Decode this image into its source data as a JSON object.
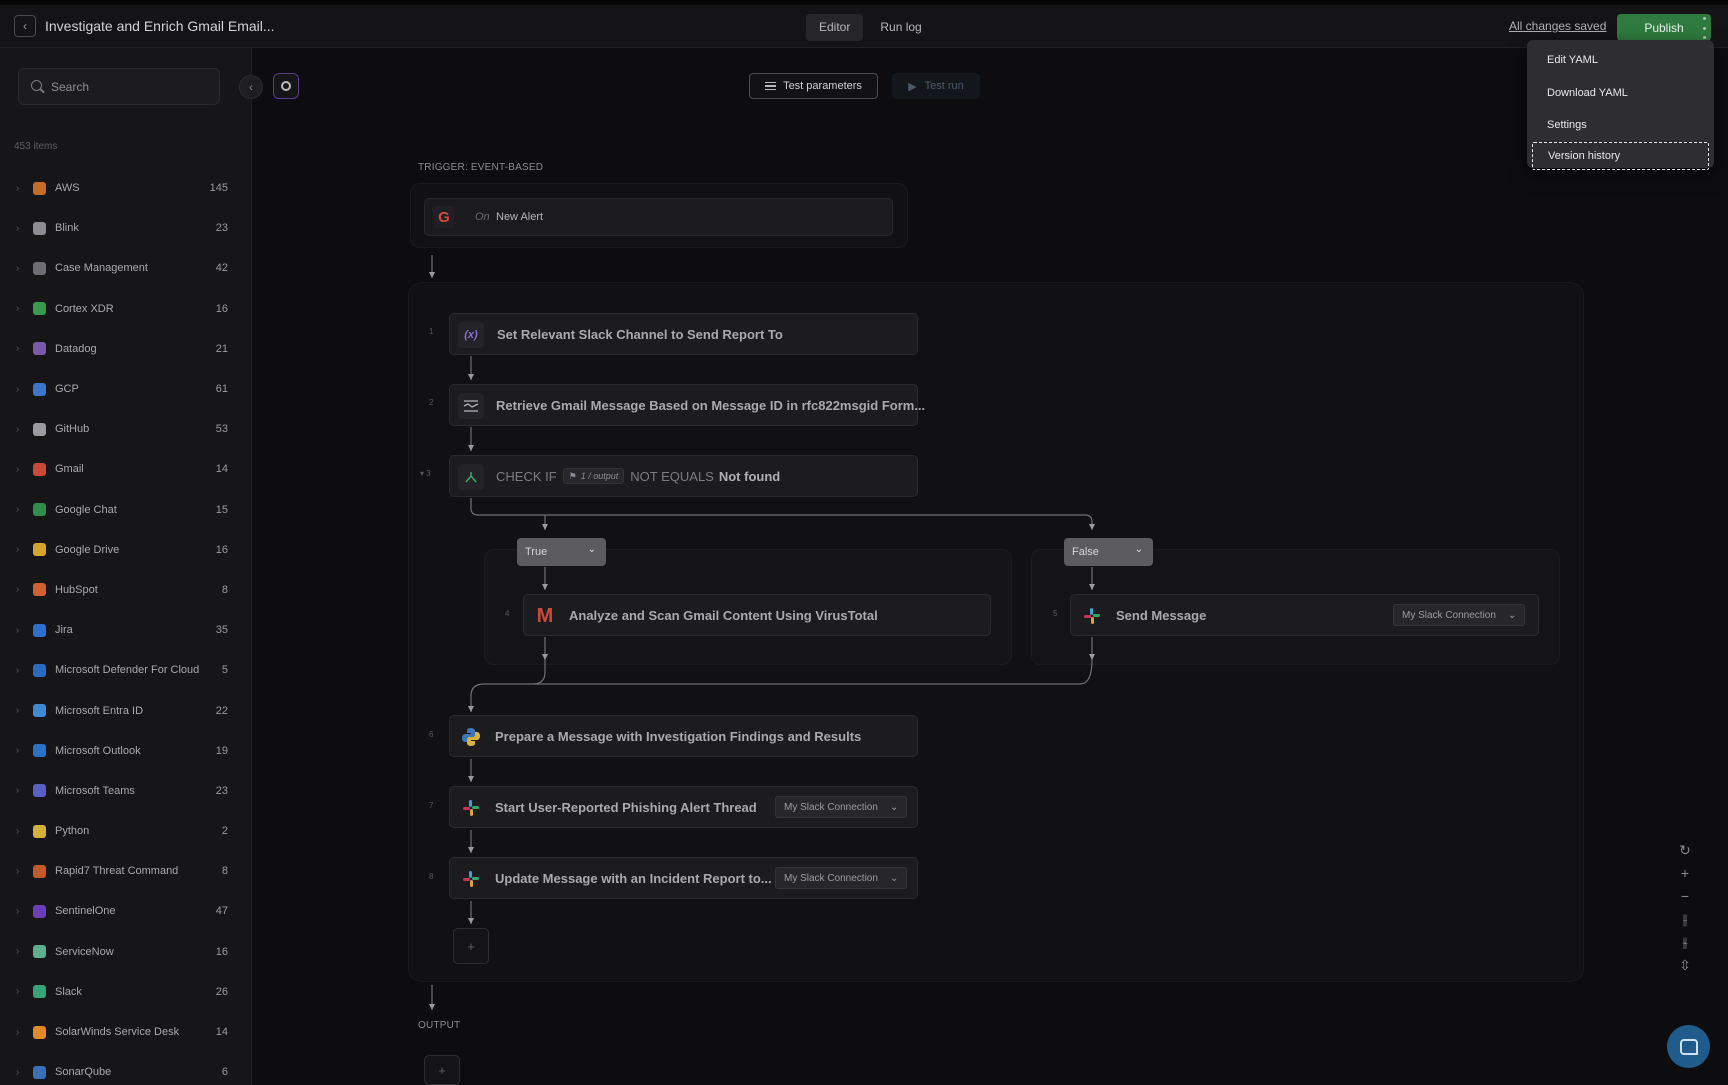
{
  "header": {
    "back_icon": "chevron-left-icon",
    "title": "Investigate and Enrich Gmail Email...",
    "tabs": [
      {
        "label": "Editor"
      },
      {
        "label": "Run log"
      }
    ],
    "saved_status": "All changes saved",
    "publish_label": "Publish",
    "more_icon": "kebab-menu-icon"
  },
  "menu": {
    "items": [
      {
        "label": "Edit YAML"
      },
      {
        "label": "Download YAML"
      },
      {
        "label": "Settings"
      },
      {
        "label": "Version history"
      }
    ]
  },
  "sidebar": {
    "search_placeholder": "Search",
    "item_count": "453 items",
    "items": [
      {
        "name": "AWS",
        "count": "145",
        "color": "#c46d2b"
      },
      {
        "name": "Blink",
        "count": "23",
        "color": "#8c8c92"
      },
      {
        "name": "Case Management",
        "count": "42",
        "color": "#6d6d73"
      },
      {
        "name": "Cortex XDR",
        "count": "16",
        "color": "#3a9a4b"
      },
      {
        "name": "Datadog",
        "count": "21",
        "color": "#7a5aa6"
      },
      {
        "name": "GCP",
        "count": "61",
        "color": "#3c76c9"
      },
      {
        "name": "GitHub",
        "count": "53",
        "color": "#9a9aa0"
      },
      {
        "name": "Gmail",
        "count": "14",
        "color": "#c9493b"
      },
      {
        "name": "Google Chat",
        "count": "15",
        "color": "#2f8f4a"
      },
      {
        "name": "Google Drive",
        "count": "16",
        "color": "#d4a72c"
      },
      {
        "name": "HubSpot",
        "count": "8",
        "color": "#d0602f"
      },
      {
        "name": "Jira",
        "count": "35",
        "color": "#2f6fce"
      },
      {
        "name": "Microsoft Defender For Cloud",
        "count": "5",
        "color": "#2a6bbf"
      },
      {
        "name": "Microsoft Entra ID",
        "count": "22",
        "color": "#3f8ad1"
      },
      {
        "name": "Microsoft Outlook",
        "count": "19",
        "color": "#2a73c4"
      },
      {
        "name": "Microsoft Teams",
        "count": "23",
        "color": "#5a5fc2"
      },
      {
        "name": "Python",
        "count": "2",
        "color": "#d2b23a"
      },
      {
        "name": "Rapid7 Threat Command",
        "count": "8",
        "color": "#c25a2a"
      },
      {
        "name": "SentinelOne",
        "count": "47",
        "color": "#6a3fb5"
      },
      {
        "name": "ServiceNow",
        "count": "16",
        "color": "#5fae8e"
      },
      {
        "name": "Slack",
        "count": "26",
        "color": "#3aa27a"
      },
      {
        "name": "SolarWinds Service Desk",
        "count": "14",
        "color": "#e08a2a"
      },
      {
        "name": "SonarQube",
        "count": "6",
        "color": "#3c6fb8"
      }
    ]
  },
  "toolbar": {
    "test_parameters": "Test parameters",
    "test_run": "Test run"
  },
  "flow": {
    "trigger_label": "TRIGGER: EVENT-BASED",
    "trigger_on": "On",
    "trigger_name": "New Alert",
    "steps": {
      "s1": {
        "no": "1",
        "title": "Set Relevant Slack Channel to Send Report To",
        "icon": "(x)"
      },
      "s2": {
        "no": "2",
        "title": "Retrieve Gmail Message Based on Message ID in rfc822msgid Form..."
      },
      "s3": {
        "no": "3",
        "prefix": "CHECK IF",
        "chip": "1 / output",
        "op": "NOT EQUALS",
        "value": "Not found"
      },
      "s4": {
        "no": "4",
        "title": "Analyze and Scan Gmail Content Using VirusTotal"
      },
      "s5": {
        "no": "5",
        "title": "Send Message",
        "connection": "My Slack Connection"
      },
      "s6": {
        "no": "6",
        "title": "Prepare a Message with Investigation Findings and Results"
      },
      "s7": {
        "no": "7",
        "title": "Start User-Reported Phishing Alert Thread",
        "connection": "My Slack Connection"
      },
      "s8": {
        "no": "8",
        "title": "Update Message with an Incident Report to...",
        "connection": "My Slack Connection"
      }
    },
    "branch_true": "True",
    "branch_false": "False",
    "output_label": "OUTPUT",
    "add_symbol": "+"
  },
  "zoom_controls": [
    "↻",
    "+",
    "−",
    "⫲",
    "⫳",
    "⇳"
  ]
}
